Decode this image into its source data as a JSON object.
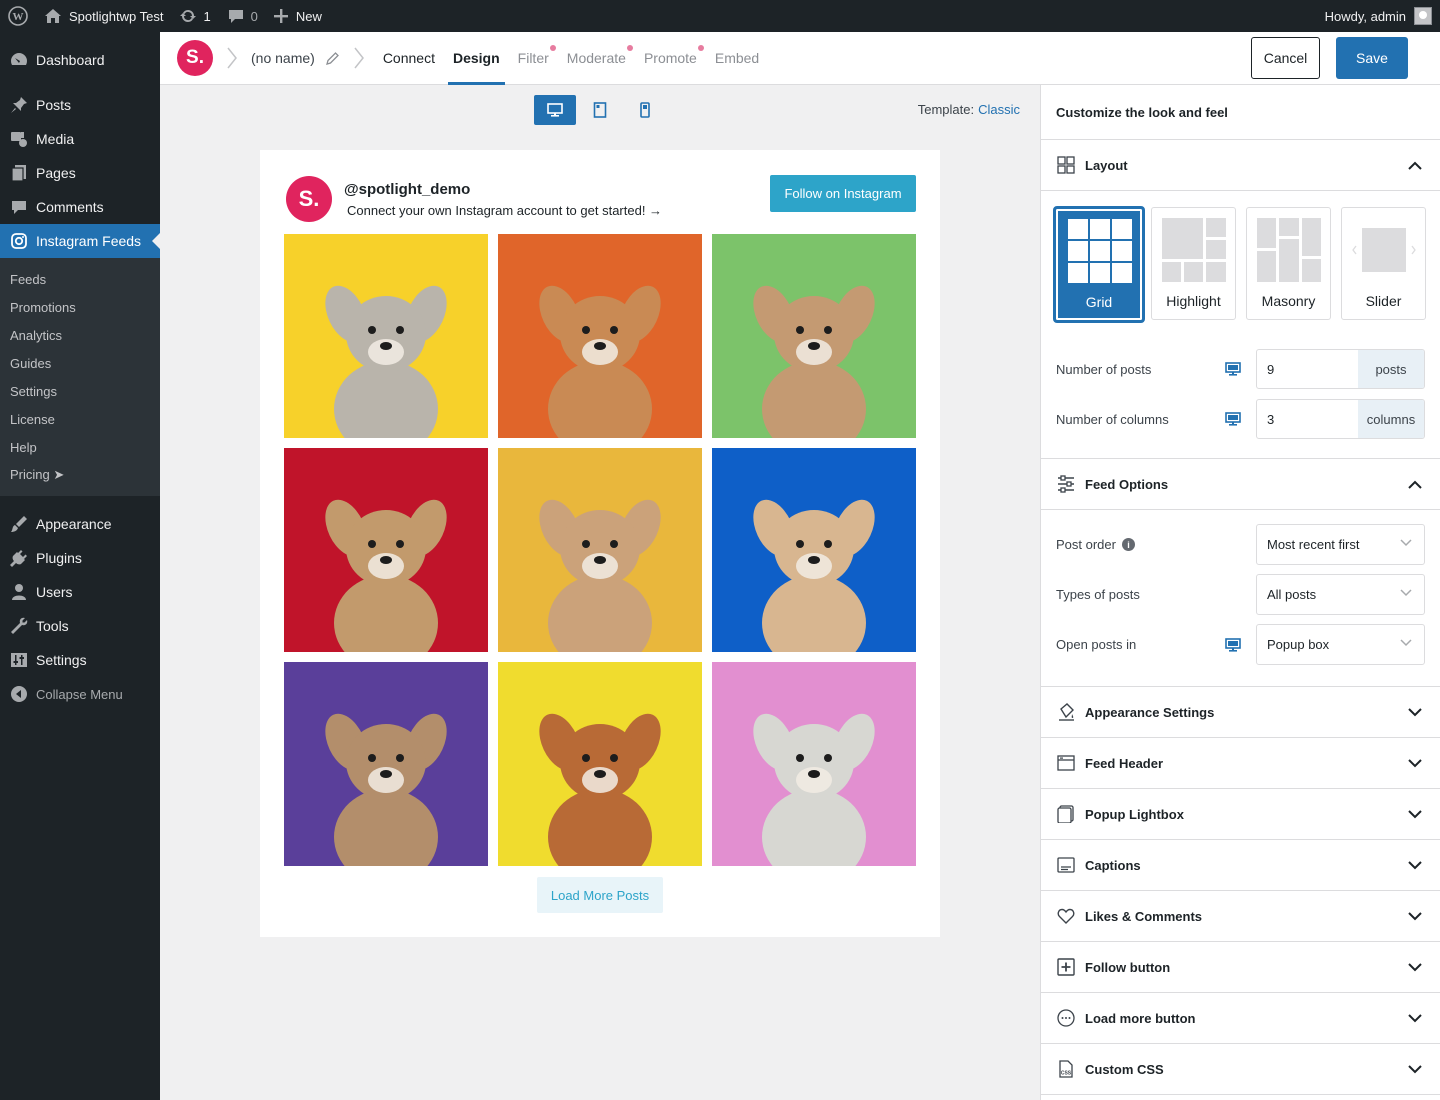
{
  "admin_bar": {
    "site_name": "Spotlightwp Test",
    "updates_count": "1",
    "comments_count": "0",
    "new_label": "New",
    "howdy": "Howdy, admin"
  },
  "sidebar": {
    "items_top": [
      {
        "label": "Dashboard",
        "icon": "dashboard-icon"
      },
      {
        "label": "Posts",
        "icon": "pin-icon"
      },
      {
        "label": "Media",
        "icon": "media-icon"
      },
      {
        "label": "Pages",
        "icon": "pages-icon"
      },
      {
        "label": "Comments",
        "icon": "comment-icon"
      },
      {
        "label": "Instagram Feeds",
        "icon": "instagram-icon"
      }
    ],
    "submenu": [
      "Feeds",
      "Promotions",
      "Analytics",
      "Guides",
      "Settings",
      "License",
      "Help",
      "Pricing ➤"
    ],
    "items_bottom": [
      {
        "label": "Appearance",
        "icon": "brush-icon"
      },
      {
        "label": "Plugins",
        "icon": "plug-icon"
      },
      {
        "label": "Users",
        "icon": "user-icon"
      },
      {
        "label": "Tools",
        "icon": "wrench-icon"
      },
      {
        "label": "Settings",
        "icon": "sliders-icon"
      },
      {
        "label": "Collapse Menu",
        "icon": "collapse-icon"
      }
    ]
  },
  "editor": {
    "logo_letter": "S.",
    "feed_name": "(no name)",
    "tabs": [
      {
        "label": "Connect",
        "state": "plain",
        "dot": false
      },
      {
        "label": "Design",
        "state": "active",
        "dot": false
      },
      {
        "label": "Filter",
        "state": "muted",
        "dot": true
      },
      {
        "label": "Moderate",
        "state": "muted",
        "dot": true
      },
      {
        "label": "Promote",
        "state": "muted",
        "dot": true
      },
      {
        "label": "Embed",
        "state": "muted",
        "dot": false
      }
    ],
    "cancel_label": "Cancel",
    "save_label": "Save"
  },
  "preview": {
    "template_label": "Template:",
    "template_value": "Classic",
    "username": "@spotlight_demo",
    "bio": "Connect your own Instagram account to get started! →",
    "follow_label": "Follow on Instagram",
    "load_more_label": "Load More Posts",
    "avatar_letter": "S.",
    "posts": [
      {
        "bg": "#f7d12a",
        "dog": "#b9b4ab"
      },
      {
        "bg": "#e0652a",
        "dog": "#c98a54"
      },
      {
        "bg": "#7cc36a",
        "dog": "#c49a72"
      },
      {
        "bg": "#c0142a",
        "dog": "#c29a6c"
      },
      {
        "bg": "#e9b73c",
        "dog": "#cba27a"
      },
      {
        "bg": "#0e5fc8",
        "dog": "#d8b690"
      },
      {
        "bg": "#5a3f9a",
        "dog": "#b38e6b"
      },
      {
        "bg": "#f0dc2e",
        "dog": "#b86a36"
      },
      {
        "bg": "#e28fd0",
        "dog": "#d7d7d2"
      }
    ]
  },
  "panel": {
    "title": "Customize the look and feel",
    "layout": {
      "heading": "Layout",
      "options": [
        "Grid",
        "Highlight",
        "Masonry",
        "Slider"
      ],
      "selected": "Grid",
      "num_posts_label": "Number of posts",
      "num_posts_value": "9",
      "num_posts_unit": "posts",
      "num_cols_label": "Number of columns",
      "num_cols_value": "3",
      "num_cols_unit": "columns"
    },
    "feed_options": {
      "heading": "Feed Options",
      "post_order_label": "Post order",
      "post_order_value": "Most recent first",
      "types_label": "Types of posts",
      "types_value": "All posts",
      "open_label": "Open posts in",
      "open_value": "Popup box"
    },
    "sections": [
      {
        "label": "Appearance Settings",
        "icon": "paint-bucket-icon"
      },
      {
        "label": "Feed Header",
        "icon": "header-icon"
      },
      {
        "label": "Popup Lightbox",
        "icon": "lightbox-icon"
      },
      {
        "label": "Captions",
        "icon": "captions-icon"
      },
      {
        "label": "Likes & Comments",
        "icon": "heart-icon"
      },
      {
        "label": "Follow button",
        "icon": "plus-square-icon"
      },
      {
        "label": "Load more button",
        "icon": "dots-circle-icon"
      },
      {
        "label": "Custom CSS",
        "icon": "css-file-icon"
      }
    ]
  }
}
